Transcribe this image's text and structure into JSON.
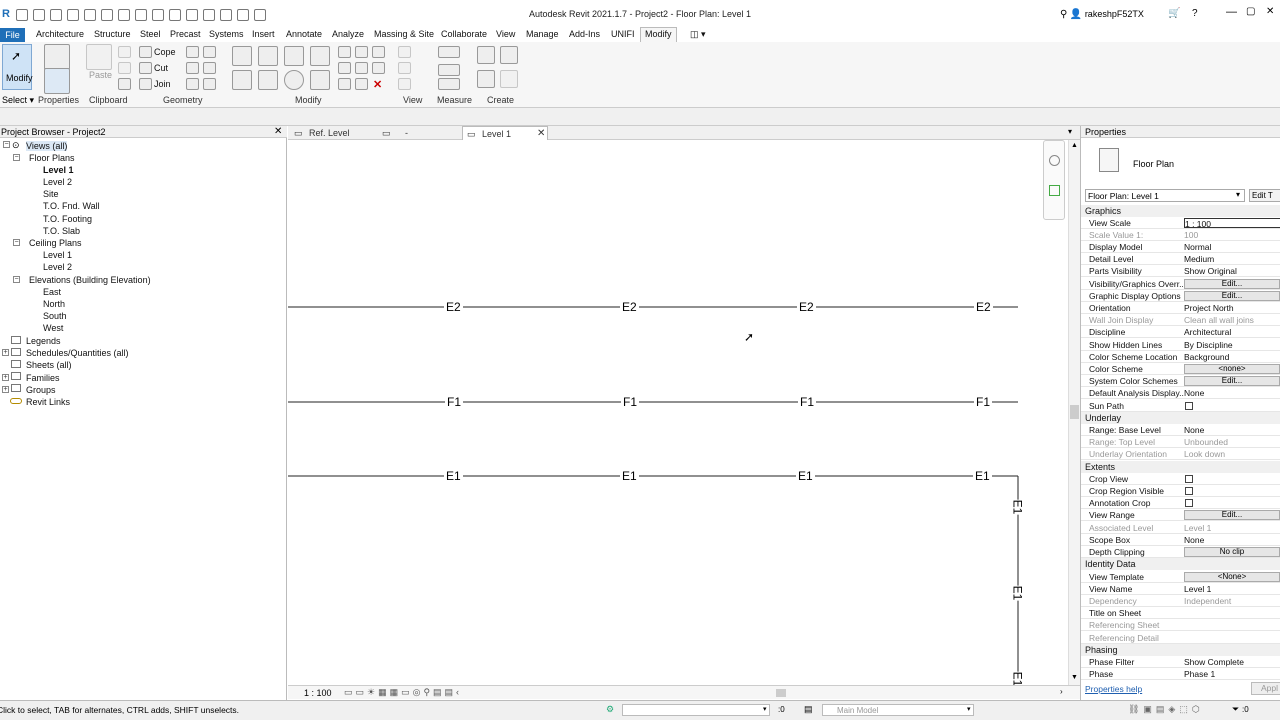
{
  "window": {
    "title": "Autodesk Revit 2021.1.7 - Project2 - Floor Plan: Level 1",
    "user": "rakeshpF52TX"
  },
  "ribbon": {
    "file_tab": "File",
    "tabs": [
      "Architecture",
      "Structure",
      "Steel",
      "Precast",
      "Systems",
      "Insert",
      "Annotate",
      "Analyze",
      "Massing & Site",
      "Collaborate",
      "View",
      "Manage",
      "Add-Ins",
      "UNIFI",
      "Modify"
    ],
    "panels": {
      "modify_btn": "Modify",
      "select": "Select",
      "properties": "Properties",
      "clipboard": "Clipboard",
      "paste": "Paste",
      "geometry": "Geometry",
      "modify": "Modify",
      "view": "View",
      "measure": "Measure",
      "create": "Create",
      "cope": "Cope",
      "cut": "Cut",
      "join": "Join"
    }
  },
  "browser": {
    "title": "Project Browser - Project2",
    "items": {
      "views_all": "Views (all)",
      "floor_plans": "Floor Plans",
      "fp_level1": "Level 1",
      "fp_level2": "Level 2",
      "fp_site": "Site",
      "fp_fnd_wall": "T.O. Fnd. Wall",
      "fp_footing": "T.O. Footing",
      "fp_slab": "T.O. Slab",
      "ceiling_plans": "Ceiling Plans",
      "cp_level1": "Level 1",
      "cp_level2": "Level 2",
      "elevations": "Elevations (Building Elevation)",
      "el_east": "East",
      "el_north": "North",
      "el_south": "South",
      "el_west": "West",
      "legends": "Legends",
      "schedules": "Schedules/Quantities (all)",
      "sheets": "Sheets (all)",
      "families": "Families",
      "groups": "Groups",
      "revit_links": "Revit Links"
    }
  },
  "view_tabs": {
    "tab1": "Ref. Level",
    "tab2": "-",
    "tab3": "Level 1"
  },
  "canvas": {
    "row_e2": [
      "E2",
      "E2",
      "E2",
      "E2"
    ],
    "row_f1": [
      "F1",
      "F1",
      "F1",
      "F1"
    ],
    "row_e1": [
      "E1",
      "E1",
      "E1",
      "E1"
    ],
    "vertical_tags": [
      "E1",
      "E1",
      "E1"
    ]
  },
  "viewbar": {
    "scale": "1 : 100"
  },
  "properties": {
    "title": "Properties",
    "type_name": "Floor Plan",
    "selector": "Floor Plan: Level 1",
    "edit_type": "Edit T",
    "groups": {
      "graphics": "Graphics",
      "underlay": "Underlay",
      "extents": "Extents",
      "identity": "Identity Data",
      "phasing": "Phasing"
    },
    "rows": {
      "view_scale": [
        "View Scale",
        "1 : 100"
      ],
      "scale_value": [
        "Scale Value    1:",
        "100"
      ],
      "display_model": [
        "Display Model",
        "Normal"
      ],
      "detail_level": [
        "Detail Level",
        "Medium"
      ],
      "parts_visibility": [
        "Parts Visibility",
        "Show Original"
      ],
      "vg_overrides": [
        "Visibility/Graphics Overr...",
        "Edit..."
      ],
      "graphic_display": [
        "Graphic Display Options",
        "Edit..."
      ],
      "orientation": [
        "Orientation",
        "Project North"
      ],
      "wall_join": [
        "Wall Join Display",
        "Clean all wall joins"
      ],
      "discipline": [
        "Discipline",
        "Architectural"
      ],
      "hidden_lines": [
        "Show Hidden Lines",
        "By Discipline"
      ],
      "color_scheme_loc": [
        "Color Scheme Location",
        "Background"
      ],
      "color_scheme": [
        "Color Scheme",
        "<none>"
      ],
      "system_color": [
        "System Color Schemes",
        "Edit..."
      ],
      "default_analysis": [
        "Default Analysis Display...",
        "None"
      ],
      "sun_path": [
        "Sun Path",
        ""
      ],
      "range_base": [
        "Range: Base Level",
        "None"
      ],
      "range_top": [
        "Range: Top Level",
        "Unbounded"
      ],
      "underlay_orient": [
        "Underlay Orientation",
        "Look down"
      ],
      "crop_view": [
        "Crop View",
        ""
      ],
      "crop_region": [
        "Crop Region Visible",
        ""
      ],
      "annotation_crop": [
        "Annotation Crop",
        ""
      ],
      "view_range": [
        "View Range",
        "Edit..."
      ],
      "assoc_level": [
        "Associated Level",
        "Level 1"
      ],
      "scope_box": [
        "Scope Box",
        "None"
      ],
      "depth_clipping": [
        "Depth Clipping",
        "No clip"
      ],
      "view_template": [
        "View Template",
        "<None>"
      ],
      "view_name": [
        "View Name",
        "Level 1"
      ],
      "dependency": [
        "Dependency",
        "Independent"
      ],
      "title_on_sheet": [
        "Title on Sheet",
        ""
      ],
      "ref_sheet": [
        "Referencing Sheet",
        ""
      ],
      "ref_detail": [
        "Referencing Detail",
        ""
      ],
      "phase_filter": [
        "Phase Filter",
        "Show Complete"
      ],
      "phase": [
        "Phase",
        "Phase 1"
      ]
    },
    "help": "Properties help",
    "apply": "Appl"
  },
  "status": {
    "hint": "Click to select, TAB for alternates, CTRL adds, SHIFT unselects.",
    "model": "Main Model",
    "sel_count": ":0",
    "filter_count": ":0"
  }
}
